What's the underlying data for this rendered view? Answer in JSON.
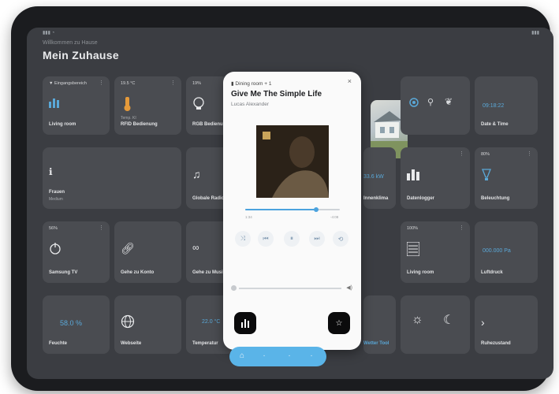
{
  "header": {
    "subtitle": "Willkommen zu Hause",
    "title": "Mein Zuhause"
  },
  "tiles": {
    "t1": {
      "tag": "▼ Eingangsbereich",
      "label": "Living room"
    },
    "t2": {
      "tag": "19.5 °C",
      "label": "RFID Bedienung",
      "sub": "Temp. KI"
    },
    "t3": {
      "tag": "19%",
      "label": "RGB Bedienung"
    },
    "t4": {
      "label": "Date & Time",
      "val": "09:18:22"
    },
    "t5": {
      "label": "Frauen",
      "sub": "Medium"
    },
    "t6": {
      "label": "Globale Radio"
    },
    "t7": {
      "label": "Innenklima",
      "val": "33.6 kW"
    },
    "t8": {
      "label": "Datenlogger"
    },
    "t9": {
      "tag": "80%",
      "label": "Beleuchtung"
    },
    "t10": {
      "tag": "56%",
      "label": "Samsung TV"
    },
    "t11": {
      "label": "Gehe zu Konto"
    },
    "t12": {
      "label": "Gehe zu Musik"
    },
    "t13": {
      "tag": "100%",
      "label": "Living room"
    },
    "t14": {
      "label": "Luftdruck",
      "val": "000.000 Pa"
    },
    "t15": {
      "label": "Feuchte",
      "val": "58.0 %"
    },
    "t16": {
      "label": "Webseite"
    },
    "t17": {
      "label": "Temperatur",
      "val": "22.0 °C"
    },
    "t18": {
      "label": "Ruhezustand"
    },
    "t19": {
      "label": "Wetter Tool"
    }
  },
  "player": {
    "source": "Dining room + 1",
    "song": "Give Me The Simple Life",
    "artist": "Lucas Alexander",
    "elapsed": "1:34",
    "remaining": "-4:08",
    "progress": 0.75
  },
  "dock": {
    "home_label": "⌂"
  }
}
